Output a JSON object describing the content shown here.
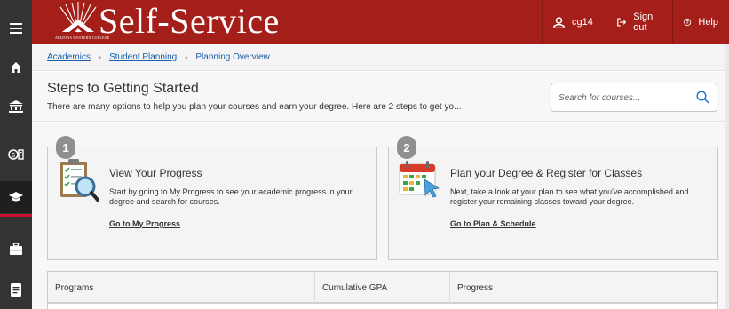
{
  "rail": {
    "items": [
      {
        "name": "menu-icon"
      },
      {
        "name": "home-icon"
      },
      {
        "name": "bank-icon"
      },
      {
        "name": "finance-icon"
      },
      {
        "name": "graduation-cap-icon"
      },
      {
        "name": "briefcase-icon"
      },
      {
        "name": "document-icon"
      }
    ]
  },
  "header": {
    "logo_text": "Self-Service",
    "logo_subtext": "ARIZONA WESTERN COLLEGE",
    "user_label": "cg14",
    "signout_label": "Sign out",
    "help_label": "Help",
    "bg_color": "#a51f1a"
  },
  "breadcrumb": {
    "items": [
      "Academics",
      "Student Planning",
      "Planning Overview"
    ]
  },
  "page": {
    "title": "Steps to Getting Started",
    "subtitle": "There are many options to help you plan your courses and earn your degree. Here are 2 steps to get yo...",
    "search_placeholder": "Search for courses..."
  },
  "cards": [
    {
      "number": "1",
      "icon": "clipboard-magnifier-icon",
      "title": "View Your Progress",
      "description": "Start by going to My Progress to see your academic progress in your degree and search for courses.",
      "link": "Go to My Progress"
    },
    {
      "number": "2",
      "icon": "calendar-cursor-icon",
      "title": "Plan your Degree & Register for Classes",
      "description": "Next, take a look at your plan to see what you've accomplished and register your remaining classes toward your degree.",
      "link": "Go to Plan & Schedule"
    }
  ],
  "table": {
    "columns": [
      "Programs",
      "Cumulative GPA",
      "Progress"
    ]
  }
}
